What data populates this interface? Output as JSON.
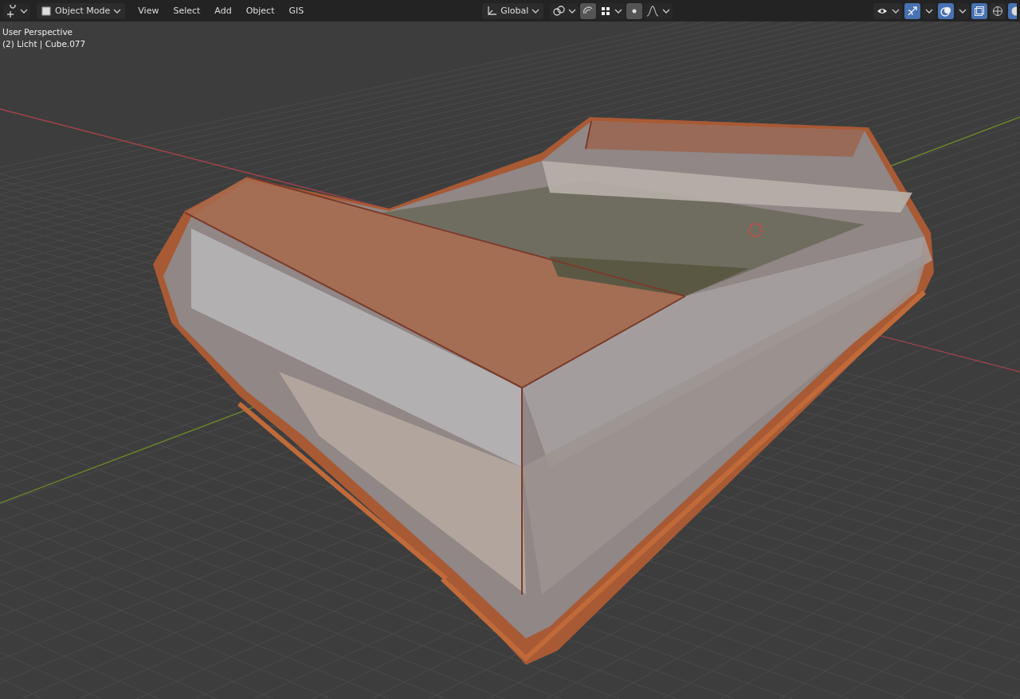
{
  "header": {
    "mode": {
      "label": "Object Mode"
    },
    "menus": [
      "View",
      "Select",
      "Add",
      "Object",
      "GIS"
    ],
    "orientation": {
      "label": "Global"
    },
    "toggles": [
      {
        "kind": "snap",
        "on": true
      },
      {
        "kind": "proportional",
        "on": true
      }
    ],
    "right_toggles": [
      {
        "kind": "visibility",
        "on": false
      },
      {
        "kind": "gizmo",
        "on": true
      },
      {
        "kind": "overlay",
        "on": true
      },
      {
        "kind": "xray",
        "on": true
      }
    ]
  },
  "viewport": {
    "view_name": "User Perspective",
    "object_info": "(2) Licht | Cube.077"
  }
}
